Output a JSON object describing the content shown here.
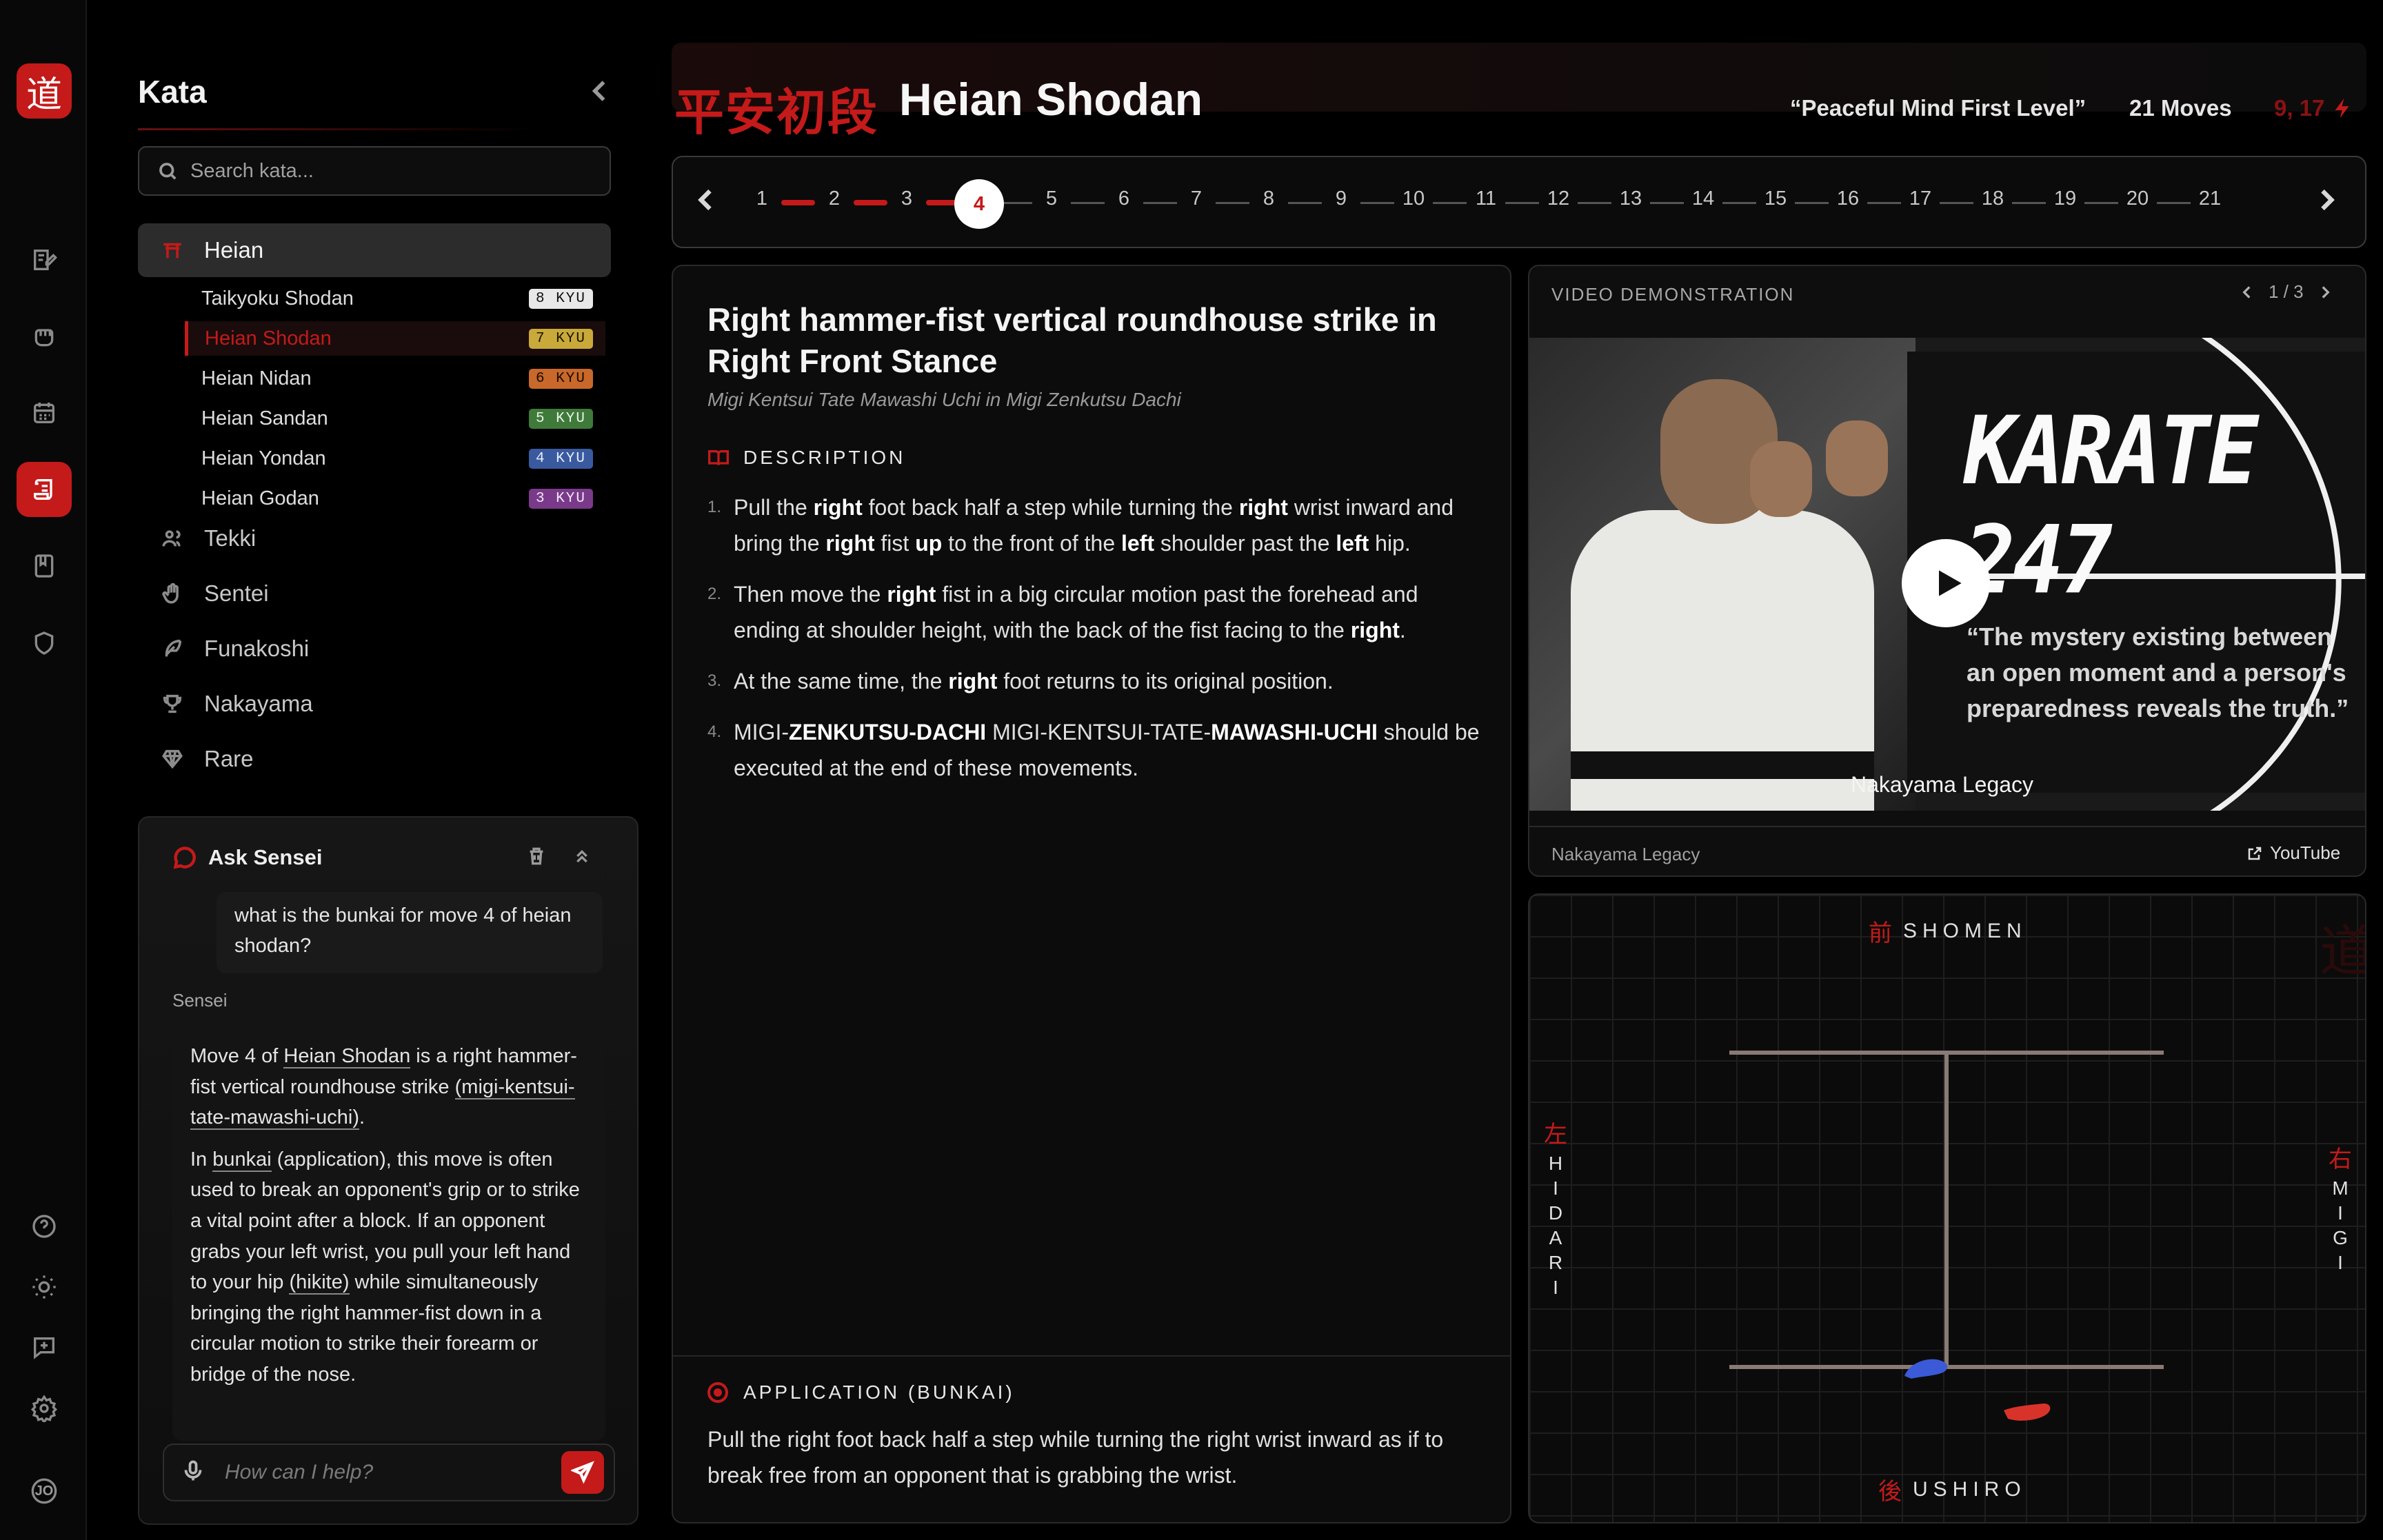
{
  "rail": {
    "logo_glyph": "道",
    "items": [
      {
        "icon": "edit-note-icon"
      },
      {
        "icon": "fist-icon"
      },
      {
        "icon": "calendar-icon"
      },
      {
        "icon": "scroll-icon",
        "active": true
      },
      {
        "icon": "book-icon"
      },
      {
        "icon": "shield-icon"
      }
    ],
    "bottom": [
      {
        "icon": "help-icon"
      },
      {
        "icon": "sun-icon"
      },
      {
        "icon": "add-chat-icon"
      },
      {
        "icon": "settings-icon"
      }
    ],
    "avatar_initials": "JO"
  },
  "sidebar": {
    "title": "Kata",
    "search_placeholder": "Search kata...",
    "groups": [
      {
        "label": "Heian",
        "icon": "torii-icon",
        "active": true
      },
      {
        "label": "Tekki",
        "icon": "users-icon"
      },
      {
        "label": "Sentei",
        "icon": "hand-icon"
      },
      {
        "label": "Funakoshi",
        "icon": "feather-icon"
      },
      {
        "label": "Nakayama",
        "icon": "trophy-icon"
      },
      {
        "label": "Rare",
        "icon": "gem-icon"
      }
    ],
    "kata": [
      {
        "name": "Taikyoku Shodan",
        "kyu": "8 KYU",
        "color": "#e8e8e8",
        "text": "#111111"
      },
      {
        "name": "Heian Shodan",
        "kyu": "7 KYU",
        "color": "#c9a93a",
        "text": "#1a1400",
        "active": true
      },
      {
        "name": "Heian Nidan",
        "kyu": "6 KYU",
        "color": "#c8682a",
        "text": "#1a0c00"
      },
      {
        "name": "Heian Sandan",
        "kyu": "5 KYU",
        "color": "#3f7a3a",
        "text": "#e8f4e6"
      },
      {
        "name": "Heian Yondan",
        "kyu": "4 KYU",
        "color": "#3a5aa0",
        "text": "#e6ecf8"
      },
      {
        "name": "Heian Godan",
        "kyu": "3 KYU",
        "color": "#7a3a8a",
        "text": "#f2e6f6"
      }
    ]
  },
  "sensei": {
    "title": "Ask Sensei",
    "user_message": "what is the bunkai for move 4 of heian shodan?",
    "assistant_label": "Sensei",
    "answer_p1_a": "Move 4 of ",
    "answer_p1_link": "Heian Shodan",
    "answer_p1_b": " is a right hammer-fist vertical roundhouse strike ",
    "answer_p1_term": "(migi-kentsui-tate-mawashi-uchi)",
    "answer_p1_c": ".",
    "answer_p2_a": "In ",
    "answer_p2_link": "bunkai",
    "answer_p2_b": " (application), this move is often used to break an opponent's grip or to strike a vital point after a block. If an opponent grabs your left wrist, you pull your left hand to your hip ",
    "answer_p2_term": "(hikite)",
    "answer_p2_c": " while simultaneously bringing the right hammer-fist down in a circular motion to strike their forearm or bridge of the nose.",
    "input_placeholder": "How can I help?"
  },
  "header": {
    "kanji": "平安初段",
    "title": "Heian Shodan",
    "meaning": "“Peaceful Mind First Level”",
    "moves": "21 Moves",
    "counts": "9, 17"
  },
  "stepper": {
    "total": 21,
    "current": 4,
    "labels": [
      "1",
      "2",
      "3",
      "4",
      "5",
      "6",
      "7",
      "8",
      "9",
      "10",
      "11",
      "12",
      "13",
      "14",
      "15",
      "16",
      "17",
      "18",
      "19",
      "20",
      "21"
    ]
  },
  "move": {
    "title": "Right hammer-fist vertical roundhouse strike in Right Front Stance",
    "subtitle": "Migi Kentsui Tate Mawashi Uchi in Migi Zenkutsu Dachi",
    "description_label": "DESCRIPTION",
    "steps": [
      {
        "n": "1.",
        "html": "Pull the <b>right</b> foot back half a step while turning the <b>right</b> wrist inward and bring the <b>right</b> fist <b>up</b> to the front of the <b>left</b> shoulder past the <b>left</b> hip."
      },
      {
        "n": "2.",
        "html": "Then move the <b>right</b> fist in a big circular motion past the forehead and ending at shoulder height, with the back of the fist facing to the <b>right</b>."
      },
      {
        "n": "3.",
        "html": "At the same time, the <b>right</b> foot returns to its original position."
      },
      {
        "n": "4.",
        "html": "MIGI-<b>ZENKUTSU-DACHI</b> MIGI-KENTSUI-TATE-<b>MAWASHI-UCHI</b> should be executed at the end of these movements."
      }
    ],
    "bunkai_label": "APPLICATION (BUNKAI)",
    "bunkai_text": "Pull the right foot back half a step while turning the right wrist inward as if to break free from an opponent that is grabbing the wrist."
  },
  "video": {
    "label": "VIDEO DEMONSTRATION",
    "pager": "1 / 3",
    "thumb_title": "KARATE 247",
    "thumb_quote": "“The mystery existing between an open moment and a person's preparedness reveals the truth.”",
    "thumb_caption": "Nakayama Legacy",
    "source": "Nakayama Legacy",
    "link_label": "YouTube"
  },
  "embusen": {
    "front_kanji": "前",
    "front": "SHOMEN",
    "back_kanji": "後",
    "back": "USHIRO",
    "left_kanji": "左",
    "left_letters": [
      "H",
      "I",
      "D",
      "A",
      "R",
      "I"
    ],
    "right_kanji": "右",
    "right_letters": [
      "M",
      "I",
      "G",
      "I"
    ],
    "colors": {
      "left_foot": "#3a5ad8",
      "right_foot": "#d8332a",
      "line": "#8a7a76"
    }
  }
}
